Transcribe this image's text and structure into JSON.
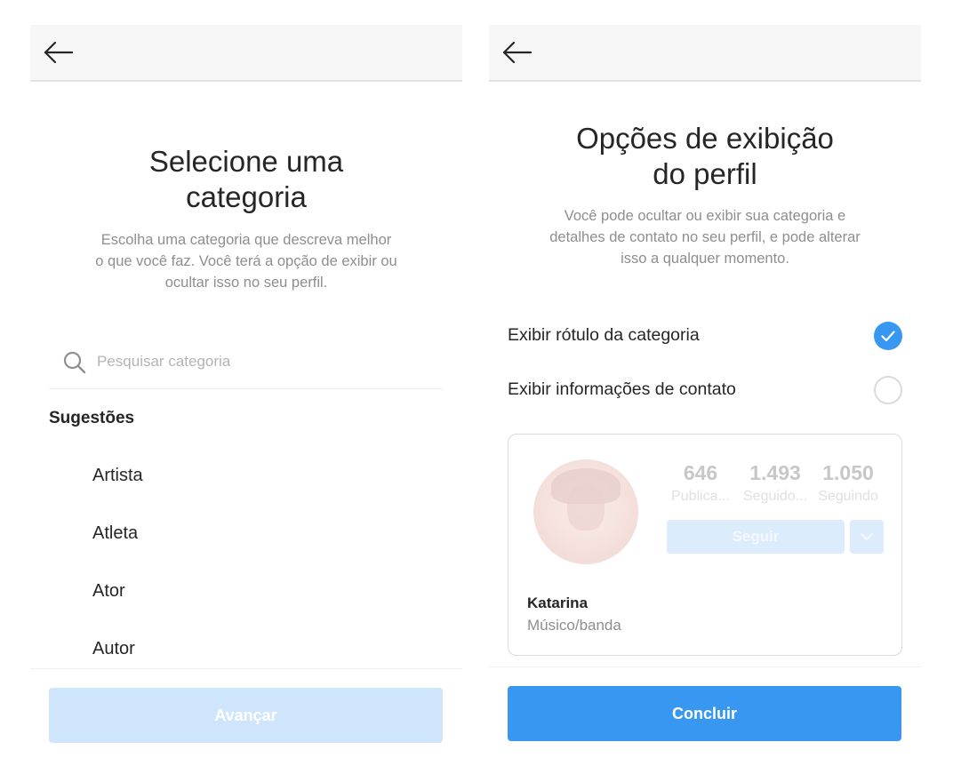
{
  "left_screen": {
    "title": "Selecione uma\ncategoria",
    "description": "Escolha uma categoria que descreva melhor\no que você faz. Você terá a opção de exibir ou\nocultar isso no seu perfil.",
    "search": {
      "placeholder": "Pesquisar categoria",
      "value": ""
    },
    "suggestions_label": "Sugestões",
    "categories": [
      "Artista",
      "Atleta",
      "Ator",
      "Autor"
    ],
    "advance_button": "Avançar",
    "advance_button_color": "#cfe5fc"
  },
  "right_screen": {
    "title": "Opções de exibição\ndo perfil",
    "description": "Você pode ocultar ou exibir sua categoria e\ndetalhes de contato no seu perfil, e pode alterar\nisso a qualquer momento.",
    "options": [
      {
        "label": "Exibir rótulo da categoria",
        "checked": true
      },
      {
        "label": "Exibir informações de contato",
        "checked": false
      }
    ],
    "preview": {
      "stats": [
        {
          "value": "646",
          "label": "Publica..."
        },
        {
          "value": "1.493",
          "label": "Seguido..."
        },
        {
          "value": "1.050",
          "label": "Seguindo"
        }
      ],
      "follow_button": "Seguir",
      "name": "Katarina",
      "category": "Músico/banda"
    },
    "conclude_button": "Concluir",
    "accent_color": "#3897f0"
  },
  "icons": {
    "back": "arrow-left-icon",
    "search": "search-icon",
    "check": "checkmark-icon",
    "dropdown": "chevron-down-icon"
  }
}
